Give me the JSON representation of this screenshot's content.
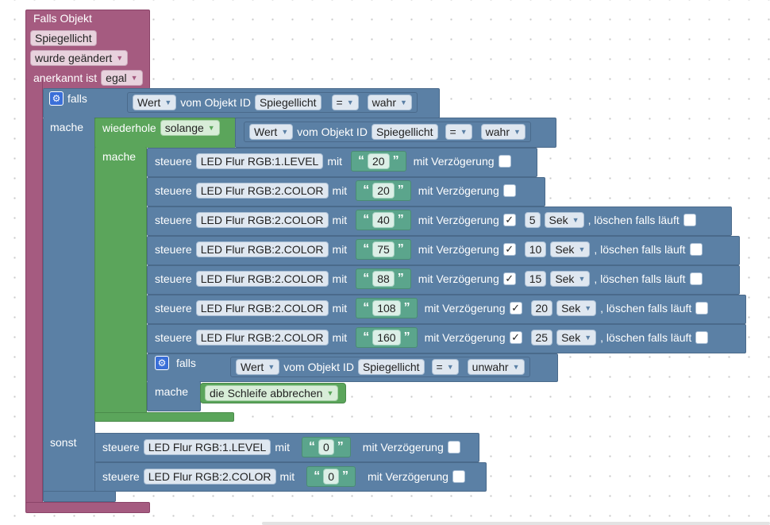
{
  "event": {
    "title": "Falls Objekt",
    "object": "Spiegellicht",
    "trigger": "wurde geändert",
    "ack_label": "anerkannt ist",
    "ack_value": "egal"
  },
  "if_block": {
    "falls": "falls",
    "mache": "mache",
    "sonst": "sonst",
    "cond": {
      "field": "Wert",
      "of": "vom Objekt ID",
      "object": "Spiegellicht",
      "op": "=",
      "value": "wahr"
    }
  },
  "loop": {
    "label": "wiederhole",
    "mode": "solange",
    "mache": "mache",
    "cond": {
      "field": "Wert",
      "of": "vom Objekt ID",
      "object": "Spiegellicht",
      "op": "=",
      "value": "wahr"
    }
  },
  "common": {
    "steuere": "steuere",
    "mit": "mit",
    "mit_verz": "mit Verzögerung",
    "loeschen": ", löschen falls läuft",
    "open_quote": "“",
    "close_quote": "”",
    "check": "✓"
  },
  "loop_actions": [
    {
      "target": "LED Flur RGB:1.LEVEL",
      "value": "20",
      "delayed": false
    },
    {
      "target": "LED Flur RGB:2.COLOR",
      "value": "20",
      "delayed": false
    },
    {
      "target": "LED Flur RGB:2.COLOR",
      "value": "40",
      "delayed": true,
      "delay": "5",
      "unit": "Sek"
    },
    {
      "target": "LED Flur RGB:2.COLOR",
      "value": "75",
      "delayed": true,
      "delay": "10",
      "unit": "Sek"
    },
    {
      "target": "LED Flur RGB:2.COLOR",
      "value": "88",
      "delayed": true,
      "delay": "15",
      "unit": "Sek"
    },
    {
      "target": "LED Flur RGB:2.COLOR",
      "value": "108",
      "delayed": true,
      "delay": "20",
      "unit": "Sek"
    },
    {
      "target": "LED Flur RGB:2.COLOR",
      "value": "160",
      "delayed": true,
      "delay": "25",
      "unit": "Sek"
    }
  ],
  "inner_if": {
    "falls": "falls",
    "mache": "mache",
    "cond": {
      "field": "Wert",
      "of": "vom Objekt ID",
      "object": "Spiegellicht",
      "op": "=",
      "value": "unwahr"
    },
    "break_label": "die Schleife abbrechen"
  },
  "else_actions": [
    {
      "target": "LED Flur RGB:1.LEVEL",
      "value": "0",
      "delayed": false
    },
    {
      "target": "LED Flur RGB:2.COLOR",
      "value": "0",
      "delayed": false
    }
  ],
  "colors": {
    "event": "#a55b80",
    "control": "#5b80a5",
    "loop": "#5ba55b",
    "text": "#5ba58c"
  }
}
